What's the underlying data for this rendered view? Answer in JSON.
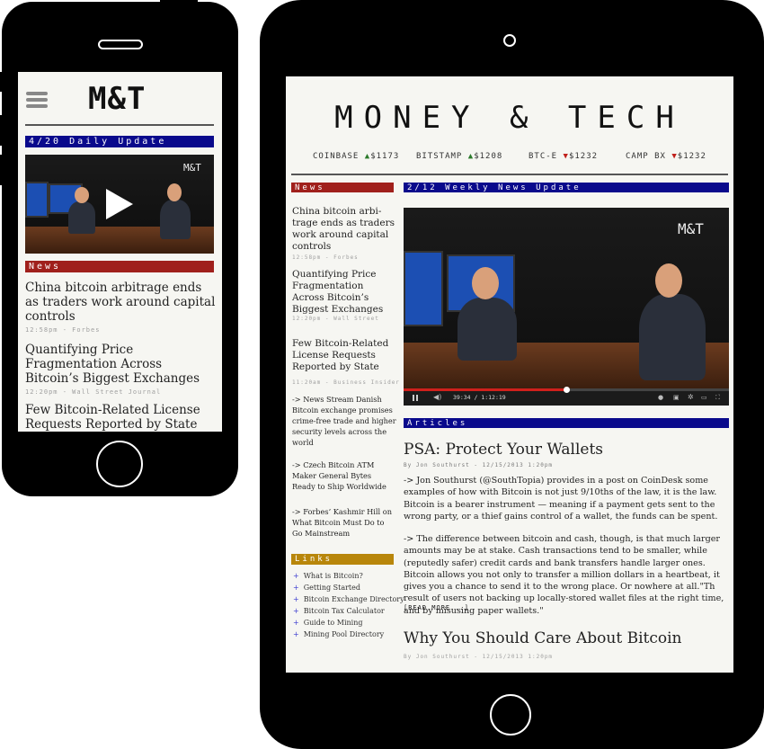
{
  "phone": {
    "logo": "M&T",
    "update_bar": "4/20 Daily Update",
    "video_logo": "M&T",
    "news_bar": "News",
    "stories": [
      {
        "title": "China bitcoin arbitrage ends as traders work around capital controls",
        "meta": "12:58pm - Forbes"
      },
      {
        "title": "Quantifying Price Fragmentation Across Bitcoin’s Biggest Exchanges",
        "meta": "12:20pm - Wall Street Journal"
      },
      {
        "title": "Few Bitcoin-Related License Requests Reported by State Agen-",
        "meta": ""
      }
    ]
  },
  "tablet": {
    "masthead": "MONEY & TECH",
    "ticker": [
      {
        "name": "COINBASE",
        "dir": "▲",
        "price": "$1173",
        "trend": "up"
      },
      {
        "name": "BITSTAMP",
        "dir": "▲",
        "price": "$1208",
        "trend": "up"
      },
      {
        "name": "BTC-E",
        "dir": "▼",
        "price": "$1232",
        "trend": "down"
      },
      {
        "name": "CAMP BX",
        "dir": "▼",
        "price": "$1232",
        "trend": "down"
      }
    ],
    "news_bar": "News",
    "weekly_bar": "2/12 Weekly News Update",
    "video_logo": "M&T",
    "video_time": "39:34 / 1:12:19",
    "video_progress": 0.5,
    "news": [
      {
        "title": "China bitcoin arbi-trage ends as traders work around capital controls",
        "meta": "12:58pm - Forbes"
      },
      {
        "title": "Quantifying Price Fragmentation Across Bitcoin’s Biggest Exchanges",
        "meta": "12:20pm - Wall Street"
      },
      {
        "title": "Few Bitcoin-Related License Requests Reported by State",
        "meta": "11:20am - Business Insider"
      }
    ],
    "briefs": [
      "-> News Stream Danish Bitcoin exchange promises crime-free trade and higher security levels across the world",
      "-> Czech Bitcoin ATM Maker General Bytes Ready to Ship Worldwide",
      "-> Forbes’ Kashmir Hill on What Bitcoin Must Do to Go Mainstream"
    ],
    "links_bar": "Links",
    "links": [
      "What is Bitcoin?",
      "Getting Started",
      "Bitcoin Exchange Directory",
      "Bitcoin Tax Calculator",
      "Guide to Mining",
      "Mining Pool Directory"
    ],
    "articles_bar": "Articles",
    "article1": {
      "title": "PSA: Protect Your Wallets",
      "byline": "By Jon Southurst - 12/15/2013 1:20pm",
      "para1": "-> Jon Southurst (@SouthTopia) provides in a post on CoinDesk some examples of how with Bitcoin is not just 9/10ths of the law, it is the law.  Bitcoin is a bearer instrument — meaning if a payment gets sent to the wrong party, or a thief gains control of a wallet, the funds can be spent.",
      "para2": "-> The difference between bitcoin and cash, though, is that much larger amounts may be at stake. Cash transactions tend to be smaller, while (reputedly safer) credit cards and bank transfers handle larger ones. Bitcoin allows you not only to transfer a million dollars in a heartbeat, it gives you a chance to send it to the wrong place. Or nowhere at all.\"Th result of users not backing up locally-stored wallet files at the right time, and by misusing paper wallets.\"",
      "read_more": "[READ MORE...]"
    },
    "article2": {
      "title": "Why You Should Care About Bitcoin",
      "byline": "By Jon Southurst - 12/15/2013 1:20pm"
    }
  }
}
